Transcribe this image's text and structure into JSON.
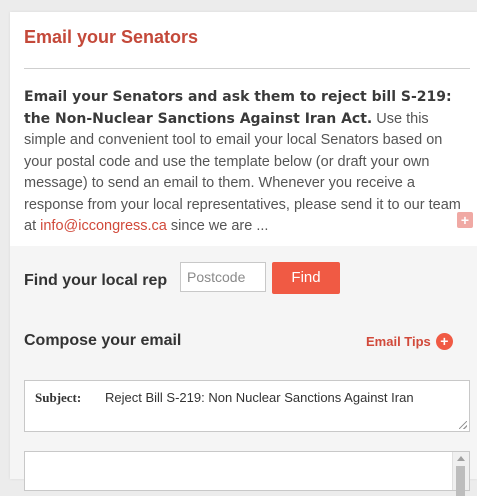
{
  "header": {
    "title": "Email your Senators"
  },
  "intro": {
    "lead": "Email your Senators and ask them to reject bill S-219: the Non-Nuclear Sanctions Against Iran Act.",
    "body": "Use this simple and convenient tool to email your local Senators based on your postal code and use the template below (or draft your own message) to send an email to them. Whenever you receive a response from your local representatives, please send it to our team at",
    "email_link": "info@iccongress.ca",
    "trail": "since we are ...",
    "expand_symbol": "+"
  },
  "find_rep": {
    "label": "Find your local rep",
    "placeholder": "Postcode",
    "button_label": "Find"
  },
  "compose": {
    "label": "Compose your email",
    "tips_label": "Email Tips",
    "tips_symbol": "+",
    "subject_label": "Subject:",
    "subject_value": "Reject Bill S-219: Non Nuclear Sanctions Against Iran"
  },
  "colors": {
    "accent": "#f05a44",
    "title_red": "#c4493a",
    "panel_gray": "#f5f5f5"
  }
}
